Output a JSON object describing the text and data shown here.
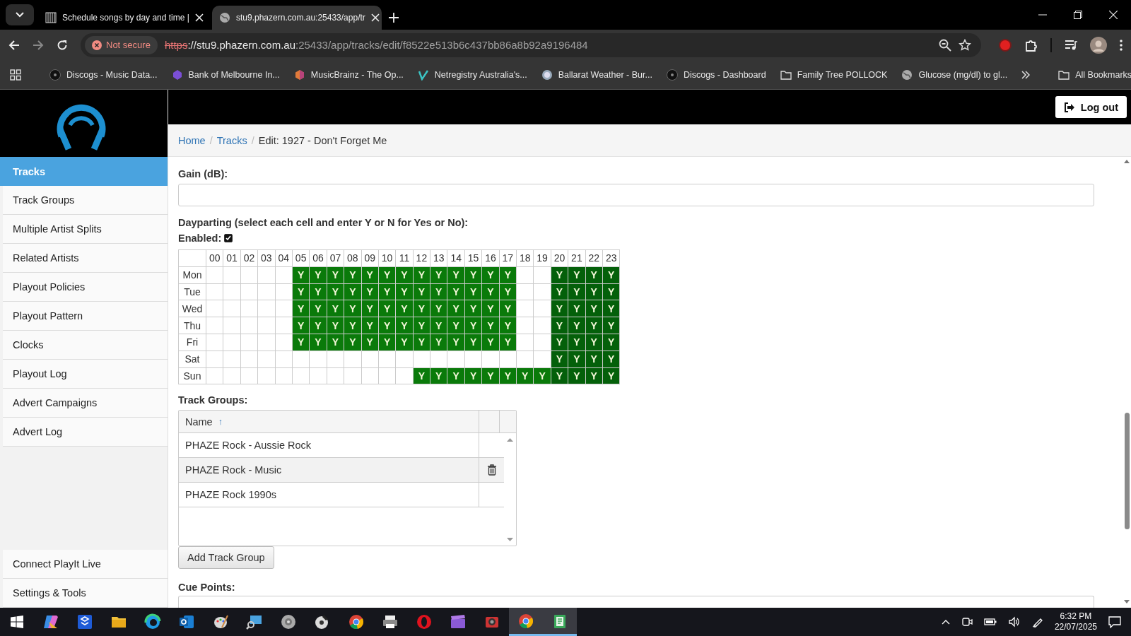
{
  "browser": {
    "tabs": [
      {
        "title": "Schedule songs by day and time |",
        "selected": false
      },
      {
        "title": "stu9.phazern.com.au:25433/app/tr",
        "selected": true
      }
    ],
    "security": "Not secure",
    "url": {
      "scheme": "https",
      "host": "://stu9.phazern.com.au",
      "path": ":25433/app/tracks/edit/f8522e513b6c437bb86a8b92a9196484"
    },
    "bookmarks": [
      {
        "label": "Discogs - Music Data...",
        "kind": "disc"
      },
      {
        "label": "Bank of Melbourne In...",
        "kind": "bank"
      },
      {
        "label": "MusicBrainz - The Op...",
        "kind": "brainz"
      },
      {
        "label": "Netregistry Australia's...",
        "kind": "net"
      },
      {
        "label": "Ballarat Weather - Bur...",
        "kind": "weather"
      },
      {
        "label": "Discogs - Dashboard",
        "kind": "disc"
      },
      {
        "label": "Family Tree POLLOCK",
        "kind": "folder"
      },
      {
        "label": "Glucose (mg/dl) to gl...",
        "kind": "globe"
      }
    ],
    "all_bookmarks": "All Bookmarks"
  },
  "header": {
    "logout": "Log out"
  },
  "sidebar": {
    "items": [
      {
        "label": "Tracks",
        "selected": true
      },
      {
        "label": "Track Groups",
        "selected": false
      },
      {
        "label": "Multiple Artist Splits",
        "selected": false
      },
      {
        "label": "Related Artists",
        "selected": false
      },
      {
        "label": "Playout Policies",
        "selected": false
      },
      {
        "label": "Playout Pattern",
        "selected": false
      },
      {
        "label": "Clocks",
        "selected": false
      },
      {
        "label": "Playout Log",
        "selected": false
      },
      {
        "label": "Advert Campaigns",
        "selected": false
      },
      {
        "label": "Advert Log",
        "selected": false
      }
    ],
    "bottom_items": [
      {
        "label": "Connect PlayIt Live",
        "selected": false
      },
      {
        "label": "Settings & Tools",
        "selected": false
      }
    ]
  },
  "breadcrumb": {
    "separator": "/",
    "items": [
      {
        "label": "Home",
        "kind": "link"
      },
      {
        "label": "Tracks",
        "kind": "link"
      },
      {
        "label": "Edit: 1927 - Don't Forget Me",
        "kind": "current"
      }
    ]
  },
  "gain": {
    "label": "Gain (dB):"
  },
  "dayparting": {
    "label": "Dayparting (select each cell and enter Y or N for Yes or No):",
    "enabled_label": "Enabled:",
    "enabled": true,
    "hours": [
      "00",
      "01",
      "02",
      "03",
      "04",
      "05",
      "06",
      "07",
      "08",
      "09",
      "10",
      "11",
      "12",
      "13",
      "14",
      "15",
      "16",
      "17",
      "18",
      "19",
      "20",
      "21",
      "22",
      "23"
    ],
    "rows": [
      {
        "day": "Mon",
        "cells": [
          {
            "on": false
          },
          {
            "on": false
          },
          {
            "on": false
          },
          {
            "on": false
          },
          {
            "on": false
          },
          {
            "on": true,
            "text": "Y",
            "dark": false
          },
          {
            "on": true,
            "text": "Y",
            "dark": false
          },
          {
            "on": true,
            "text": "Y",
            "dark": false
          },
          {
            "on": true,
            "text": "Y",
            "dark": false
          },
          {
            "on": true,
            "text": "Y",
            "dark": false
          },
          {
            "on": true,
            "text": "Y",
            "dark": false
          },
          {
            "on": true,
            "text": "Y",
            "dark": false
          },
          {
            "on": true,
            "text": "Y",
            "dark": false
          },
          {
            "on": true,
            "text": "Y",
            "dark": false
          },
          {
            "on": true,
            "text": "Y",
            "dark": false
          },
          {
            "on": true,
            "text": "Y",
            "dark": false
          },
          {
            "on": true,
            "text": "Y",
            "dark": false
          },
          {
            "on": true,
            "text": "Y",
            "dark": false
          },
          {
            "on": false
          },
          {
            "on": false
          },
          {
            "on": true,
            "text": "Y",
            "dark": true
          },
          {
            "on": true,
            "text": "Y",
            "dark": true
          },
          {
            "on": true,
            "text": "Y",
            "dark": true
          },
          {
            "on": true,
            "text": "Y",
            "dark": true
          }
        ]
      },
      {
        "day": "Tue",
        "cells": [
          {
            "on": false
          },
          {
            "on": false
          },
          {
            "on": false
          },
          {
            "on": false
          },
          {
            "on": false
          },
          {
            "on": true,
            "text": "Y",
            "dark": false
          },
          {
            "on": true,
            "text": "Y",
            "dark": false
          },
          {
            "on": true,
            "text": "Y",
            "dark": false
          },
          {
            "on": true,
            "text": "Y",
            "dark": false
          },
          {
            "on": true,
            "text": "Y",
            "dark": false
          },
          {
            "on": true,
            "text": "Y",
            "dark": false
          },
          {
            "on": true,
            "text": "Y",
            "dark": false
          },
          {
            "on": true,
            "text": "Y",
            "dark": false
          },
          {
            "on": true,
            "text": "Y",
            "dark": false
          },
          {
            "on": true,
            "text": "Y",
            "dark": false
          },
          {
            "on": true,
            "text": "Y",
            "dark": false
          },
          {
            "on": true,
            "text": "Y",
            "dark": false
          },
          {
            "on": true,
            "text": "Y",
            "dark": false
          },
          {
            "on": false
          },
          {
            "on": false
          },
          {
            "on": true,
            "text": "Y",
            "dark": true
          },
          {
            "on": true,
            "text": "Y",
            "dark": true
          },
          {
            "on": true,
            "text": "Y",
            "dark": true
          },
          {
            "on": true,
            "text": "Y",
            "dark": true
          }
        ]
      },
      {
        "day": "Wed",
        "cells": [
          {
            "on": false
          },
          {
            "on": false
          },
          {
            "on": false
          },
          {
            "on": false
          },
          {
            "on": false
          },
          {
            "on": true,
            "text": "Y",
            "dark": false
          },
          {
            "on": true,
            "text": "Y",
            "dark": false
          },
          {
            "on": true,
            "text": "Y",
            "dark": false
          },
          {
            "on": true,
            "text": "Y",
            "dark": false
          },
          {
            "on": true,
            "text": "Y",
            "dark": false
          },
          {
            "on": true,
            "text": "Y",
            "dark": false
          },
          {
            "on": true,
            "text": "Y",
            "dark": false
          },
          {
            "on": true,
            "text": "Y",
            "dark": false
          },
          {
            "on": true,
            "text": "Y",
            "dark": false
          },
          {
            "on": true,
            "text": "Y",
            "dark": false
          },
          {
            "on": true,
            "text": "Y",
            "dark": false
          },
          {
            "on": true,
            "text": "Y",
            "dark": false
          },
          {
            "on": true,
            "text": "Y",
            "dark": false
          },
          {
            "on": false
          },
          {
            "on": false
          },
          {
            "on": true,
            "text": "Y",
            "dark": true
          },
          {
            "on": true,
            "text": "Y",
            "dark": true
          },
          {
            "on": true,
            "text": "Y",
            "dark": true
          },
          {
            "on": true,
            "text": "Y",
            "dark": true
          }
        ]
      },
      {
        "day": "Thu",
        "cells": [
          {
            "on": false
          },
          {
            "on": false
          },
          {
            "on": false
          },
          {
            "on": false
          },
          {
            "on": false
          },
          {
            "on": true,
            "text": "Y",
            "dark": false
          },
          {
            "on": true,
            "text": "Y",
            "dark": false
          },
          {
            "on": true,
            "text": "Y",
            "dark": false
          },
          {
            "on": true,
            "text": "Y",
            "dark": false
          },
          {
            "on": true,
            "text": "Y",
            "dark": false
          },
          {
            "on": true,
            "text": "Y",
            "dark": false
          },
          {
            "on": true,
            "text": "Y",
            "dark": false
          },
          {
            "on": true,
            "text": "Y",
            "dark": false
          },
          {
            "on": true,
            "text": "Y",
            "dark": false
          },
          {
            "on": true,
            "text": "Y",
            "dark": false
          },
          {
            "on": true,
            "text": "Y",
            "dark": false
          },
          {
            "on": true,
            "text": "Y",
            "dark": false
          },
          {
            "on": true,
            "text": "Y",
            "dark": false
          },
          {
            "on": false
          },
          {
            "on": false
          },
          {
            "on": true,
            "text": "Y",
            "dark": true
          },
          {
            "on": true,
            "text": "Y",
            "dark": true
          },
          {
            "on": true,
            "text": "Y",
            "dark": true
          },
          {
            "on": true,
            "text": "Y",
            "dark": true
          }
        ]
      },
      {
        "day": "Fri",
        "cells": [
          {
            "on": false
          },
          {
            "on": false
          },
          {
            "on": false
          },
          {
            "on": false
          },
          {
            "on": false
          },
          {
            "on": true,
            "text": "Y",
            "dark": false
          },
          {
            "on": true,
            "text": "Y",
            "dark": false
          },
          {
            "on": true,
            "text": "Y",
            "dark": false
          },
          {
            "on": true,
            "text": "Y",
            "dark": false
          },
          {
            "on": true,
            "text": "Y",
            "dark": false
          },
          {
            "on": true,
            "text": "Y",
            "dark": false
          },
          {
            "on": true,
            "text": "Y",
            "dark": false
          },
          {
            "on": true,
            "text": "Y",
            "dark": false
          },
          {
            "on": true,
            "text": "Y",
            "dark": false
          },
          {
            "on": true,
            "text": "Y",
            "dark": false
          },
          {
            "on": true,
            "text": "Y",
            "dark": false
          },
          {
            "on": true,
            "text": "Y",
            "dark": false
          },
          {
            "on": true,
            "text": "Y",
            "dark": false
          },
          {
            "on": false
          },
          {
            "on": false
          },
          {
            "on": true,
            "text": "Y",
            "dark": true
          },
          {
            "on": true,
            "text": "Y",
            "dark": true
          },
          {
            "on": true,
            "text": "Y",
            "dark": true
          },
          {
            "on": true,
            "text": "Y",
            "dark": true
          }
        ]
      },
      {
        "day": "Sat",
        "cells": [
          {
            "on": false
          },
          {
            "on": false
          },
          {
            "on": false
          },
          {
            "on": false
          },
          {
            "on": false
          },
          {
            "on": false
          },
          {
            "on": false
          },
          {
            "on": false
          },
          {
            "on": false
          },
          {
            "on": false
          },
          {
            "on": false
          },
          {
            "on": false
          },
          {
            "on": false
          },
          {
            "on": false
          },
          {
            "on": false
          },
          {
            "on": false
          },
          {
            "on": false
          },
          {
            "on": false
          },
          {
            "on": false
          },
          {
            "on": false
          },
          {
            "on": true,
            "text": "Y",
            "dark": true
          },
          {
            "on": true,
            "text": "Y",
            "dark": true
          },
          {
            "on": true,
            "text": "Y",
            "dark": true
          },
          {
            "on": true,
            "text": "Y",
            "dark": true
          }
        ]
      },
      {
        "day": "Sun",
        "cells": [
          {
            "on": false
          },
          {
            "on": false
          },
          {
            "on": false
          },
          {
            "on": false
          },
          {
            "on": false
          },
          {
            "on": false
          },
          {
            "on": false
          },
          {
            "on": false
          },
          {
            "on": false
          },
          {
            "on": false
          },
          {
            "on": false
          },
          {
            "on": false
          },
          {
            "on": true,
            "text": "Y",
            "dark": false
          },
          {
            "on": true,
            "text": "Y",
            "dark": false
          },
          {
            "on": true,
            "text": "Y",
            "dark": false
          },
          {
            "on": true,
            "text": "Y",
            "dark": false
          },
          {
            "on": true,
            "text": "Y",
            "dark": false
          },
          {
            "on": true,
            "text": "Y",
            "dark": false
          },
          {
            "on": true,
            "text": "Y",
            "dark": false
          },
          {
            "on": true,
            "text": "Y",
            "dark": false
          },
          {
            "on": true,
            "text": "Y",
            "dark": true
          },
          {
            "on": true,
            "text": "Y",
            "dark": true
          },
          {
            "on": true,
            "text": "Y",
            "dark": true
          },
          {
            "on": true,
            "text": "Y",
            "dark": true
          }
        ]
      }
    ]
  },
  "track_groups": {
    "label": "Track Groups:",
    "columns": [
      {
        "label": "Name",
        "sort_icon": "↑"
      }
    ],
    "rows": [
      {
        "name": "PHAZE Rock - Aussie Rock",
        "selected": false
      },
      {
        "name": "PHAZE Rock - Music",
        "selected": true
      },
      {
        "name": "PHAZE Rock 1990s",
        "selected": false
      }
    ],
    "add_button": "Add Track Group"
  },
  "cue_points": {
    "label": "Cue Points:"
  },
  "taskbar": {
    "apps": [
      {
        "running": false
      },
      {
        "running": false
      },
      {
        "running": false
      },
      {
        "running": false
      },
      {
        "running": false
      },
      {
        "running": false
      },
      {
        "running": false
      },
      {
        "running": false
      },
      {
        "running": false
      },
      {
        "running": false
      },
      {
        "running": false
      },
      {
        "running": false
      },
      {
        "running": false
      },
      {
        "running": false
      },
      {
        "running": true
      },
      {
        "running": true
      }
    ],
    "time": "6:32 PM",
    "date": "22/07/2025"
  }
}
